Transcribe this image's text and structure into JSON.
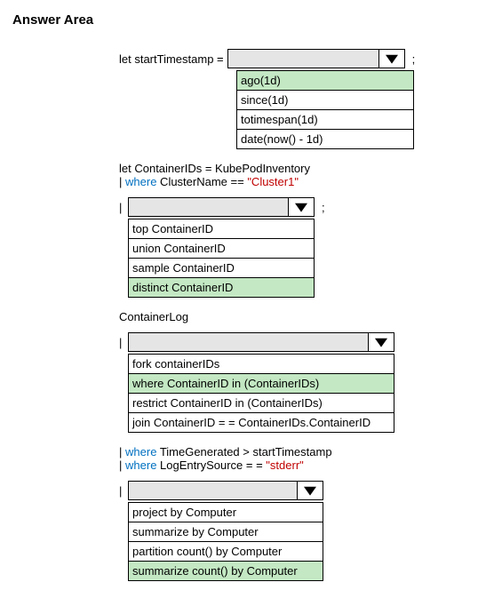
{
  "title": "Answer Area",
  "section1": {
    "label": "let startTimestamp =",
    "semicolon": ";",
    "dropdown_value": "",
    "options": [
      {
        "text": "ago(1d)",
        "selected": true
      },
      {
        "text": "since(1d)",
        "selected": false
      },
      {
        "text": "totimespan(1d)",
        "selected": false
      },
      {
        "text": "date(now() - 1d)",
        "selected": false
      }
    ]
  },
  "section2": {
    "line1": "let ContainerIDs = KubePodInventory",
    "pipe": "|",
    "where_kw": "where",
    "clusterText": " ClusterName == ",
    "clusterValue": "\"Cluster1\"",
    "pipe2": "|",
    "semicolon": ";",
    "options": [
      {
        "text": "top ContainerID",
        "selected": false
      },
      {
        "text": "union ContainerID",
        "selected": false
      },
      {
        "text": "sample ContainerID",
        "selected": false
      },
      {
        "text": "distinct ContainerID",
        "selected": true
      }
    ]
  },
  "section3": {
    "heading": "ContainerLog",
    "pipe": "|",
    "options": [
      {
        "text": "fork containerIDs",
        "selected": false
      },
      {
        "text": "where ContainerID in (ContainerIDs)",
        "selected": true
      },
      {
        "text": "restrict ContainerID in (ContainerIDs)",
        "selected": false
      },
      {
        "text": "join ContainerID = = ContainerIDs.ContainerID",
        "selected": false
      }
    ]
  },
  "section4": {
    "pipe1": "|",
    "where1": "where",
    "time_text": " TimeGenerated > startTimestamp",
    "pipe2": "|",
    "where2": "where",
    "log_text": " LogEntrySource = = ",
    "log_value": "\"stderr\"",
    "pipe3": "|",
    "options": [
      {
        "text": "project by Computer",
        "selected": false
      },
      {
        "text": "summarize by Computer",
        "selected": false
      },
      {
        "text": "partition count() by Computer",
        "selected": false
      },
      {
        "text": "summarize count() by Computer",
        "selected": true
      }
    ]
  }
}
